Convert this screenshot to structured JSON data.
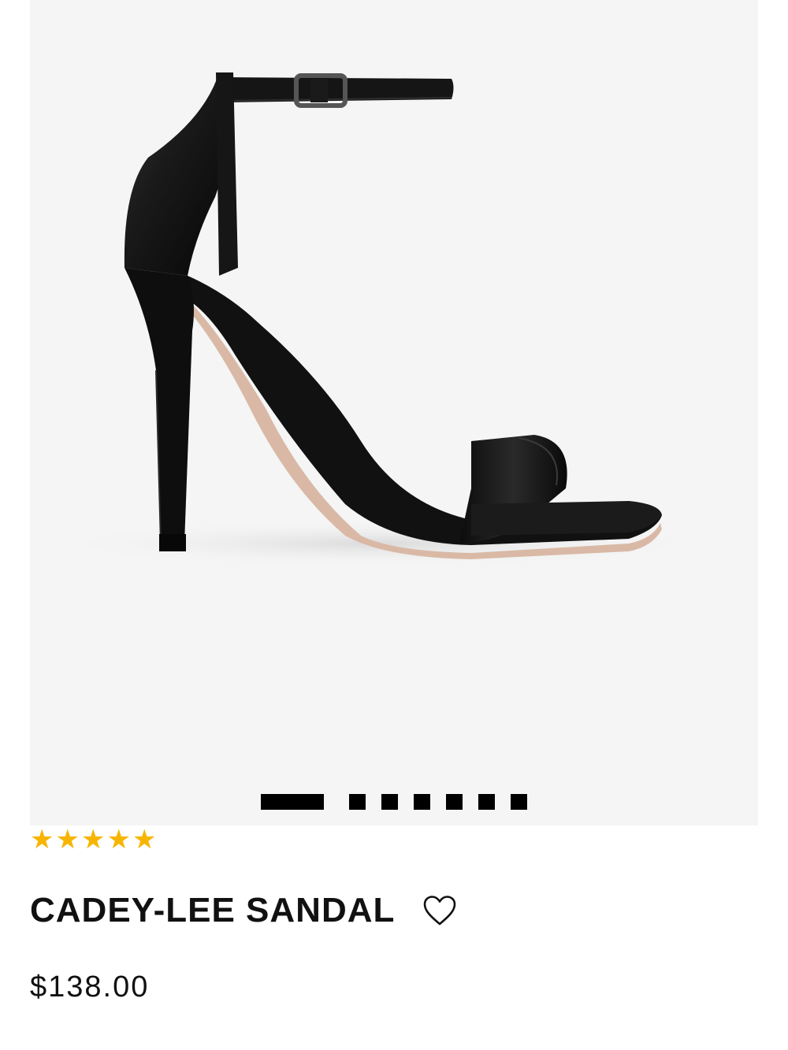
{
  "product": {
    "title": "CADEY-LEE SANDAL",
    "price": "$138.00",
    "rating": 5,
    "rating_max": 5,
    "image_alt": "black leather ankle-strap high heel sandal"
  },
  "gallery": {
    "image_count": 7,
    "active_index": 0
  },
  "icons": {
    "wishlist": "heart-outline-icon",
    "rating": "star-icon"
  },
  "colors": {
    "star": "#f7b500",
    "image_background": "#f5f5f5",
    "text": "#111111"
  }
}
